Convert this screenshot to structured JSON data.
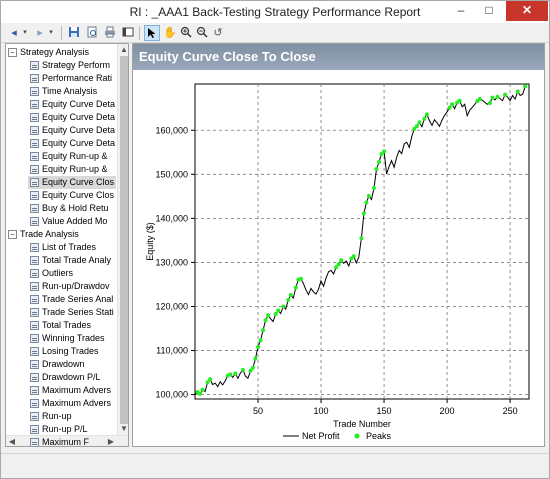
{
  "window": {
    "title": "RI : _AAA1 Back-Testing Strategy Performance Report",
    "minimize_glyph": "–",
    "maximize_glyph": "□",
    "close_glyph": "✕"
  },
  "toolbar": {
    "icons": [
      "back-arrow-icon",
      "dropdown-icon",
      "forward-arrow-icon",
      "dropdown-icon",
      "save-icon",
      "print-preview-icon",
      "print-icon",
      "layout-icon",
      "pointer-icon",
      "hand-pan-icon",
      "zoom-in-icon",
      "zoom-out-icon",
      "zoom-reset-icon"
    ]
  },
  "tree": {
    "groups": [
      {
        "label": "Strategy Analysis",
        "items": [
          "Strategy Perform",
          "Performance Rati",
          "Time Analysis",
          "Equity Curve Deta",
          "Equity Curve Deta",
          "Equity Curve Deta",
          "Equity Curve Deta",
          "Equity Run-up &",
          "Equity Run-up &",
          "Equity Curve Clos",
          "Equity Curve Clos",
          "Buy & Hold Retu",
          "Value Added Mo"
        ]
      },
      {
        "label": "Trade Analysis",
        "items": [
          "List of Trades",
          "Total Trade Analy",
          "Outliers",
          "Run-up/Drawdov",
          "Trade Series Anal",
          "Trade Series Stati",
          "Total Trades",
          "Winning Trades",
          "Losing Trades",
          "Drawdown",
          "Drawdown P/L",
          "Maximum Advers",
          "Maximum Advers",
          "Run-up",
          "Run-up P/L",
          "Maximum F"
        ]
      }
    ],
    "selected_index": 9
  },
  "panel": {
    "title": "Equity Curve Close To Close"
  },
  "chart_data": {
    "type": "line",
    "title": "",
    "xlabel": "Trade Number",
    "ylabel": "Equity ($)",
    "xlim": [
      0,
      265
    ],
    "ylim": [
      99000,
      170500
    ],
    "x_ticks": [
      50,
      100,
      150,
      200,
      250
    ],
    "y_ticks": [
      100000,
      110000,
      120000,
      130000,
      140000,
      150000,
      160000
    ],
    "y_tick_labels": [
      "100,000",
      "110,000",
      "120,000",
      "130,000",
      "140,000",
      "150,000",
      "160,000"
    ],
    "grid": true,
    "legend": "bottom",
    "series": [
      {
        "name": "Net Profit",
        "color": "#000000",
        "points": [
          [
            0,
            100000
          ],
          [
            2,
            100600
          ],
          [
            4,
            99900
          ],
          [
            6,
            101100
          ],
          [
            8,
            100700
          ],
          [
            10,
            102800
          ],
          [
            12,
            103500
          ],
          [
            14,
            102300
          ],
          [
            16,
            102600
          ],
          [
            18,
            101800
          ],
          [
            20,
            102900
          ],
          [
            22,
            102200
          ],
          [
            24,
            103100
          ],
          [
            26,
            104300
          ],
          [
            28,
            104600
          ],
          [
            30,
            103900
          ],
          [
            32,
            104800
          ],
          [
            34,
            103700
          ],
          [
            36,
            104900
          ],
          [
            38,
            105600
          ],
          [
            40,
            104200
          ],
          [
            42,
            103700
          ],
          [
            44,
            105300
          ],
          [
            46,
            106100
          ],
          [
            48,
            108200
          ],
          [
            50,
            110800
          ],
          [
            52,
            112300
          ],
          [
            54,
            114600
          ],
          [
            56,
            116900
          ],
          [
            58,
            118000
          ],
          [
            60,
            117200
          ],
          [
            62,
            116600
          ],
          [
            64,
            118300
          ],
          [
            66,
            119100
          ],
          [
            68,
            118400
          ],
          [
            70,
            120000
          ],
          [
            72,
            119400
          ],
          [
            74,
            121500
          ],
          [
            76,
            122600
          ],
          [
            78,
            121900
          ],
          [
            80,
            124300
          ],
          [
            82,
            126100
          ],
          [
            84,
            126300
          ],
          [
            86,
            125200
          ],
          [
            88,
            123800
          ],
          [
            90,
            122700
          ],
          [
            92,
            124100
          ],
          [
            94,
            123300
          ],
          [
            96,
            122800
          ],
          [
            98,
            123900
          ],
          [
            100,
            125800
          ],
          [
            102,
            124600
          ],
          [
            104,
            126500
          ],
          [
            106,
            127900
          ],
          [
            108,
            128200
          ],
          [
            110,
            127400
          ],
          [
            112,
            128900
          ],
          [
            114,
            129600
          ],
          [
            116,
            130500
          ],
          [
            118,
            129800
          ],
          [
            120,
            130300
          ],
          [
            122,
            129200
          ],
          [
            124,
            130900
          ],
          [
            126,
            131400
          ],
          [
            128,
            129900
          ],
          [
            130,
            131200
          ],
          [
            132,
            135500
          ],
          [
            134,
            141100
          ],
          [
            136,
            143600
          ],
          [
            138,
            145100
          ],
          [
            140,
            144300
          ],
          [
            142,
            146900
          ],
          [
            144,
            151200
          ],
          [
            146,
            152800
          ],
          [
            148,
            154600
          ],
          [
            150,
            155200
          ],
          [
            152,
            150100
          ],
          [
            154,
            151800
          ],
          [
            156,
            153100
          ],
          [
            158,
            151600
          ],
          [
            160,
            153900
          ],
          [
            162,
            155400
          ],
          [
            164,
            154700
          ],
          [
            166,
            156900
          ],
          [
            168,
            157300
          ],
          [
            170,
            156100
          ],
          [
            172,
            158600
          ],
          [
            174,
            160300
          ],
          [
            176,
            160900
          ],
          [
            178,
            161800
          ],
          [
            180,
            160800
          ],
          [
            182,
            162600
          ],
          [
            184,
            163600
          ],
          [
            186,
            162200
          ],
          [
            188,
            161100
          ],
          [
            190,
            162400
          ],
          [
            192,
            161700
          ],
          [
            194,
            160900
          ],
          [
            196,
            162300
          ],
          [
            198,
            163400
          ],
          [
            200,
            164200
          ],
          [
            202,
            165100
          ],
          [
            204,
            165900
          ],
          [
            206,
            164900
          ],
          [
            208,
            166300
          ],
          [
            210,
            166700
          ],
          [
            212,
            165300
          ],
          [
            214,
            165900
          ],
          [
            216,
            163300
          ],
          [
            218,
            164600
          ],
          [
            220,
            165200
          ],
          [
            222,
            165900
          ],
          [
            224,
            166600
          ],
          [
            226,
            167100
          ],
          [
            228,
            166800
          ],
          [
            230,
            166300
          ],
          [
            232,
            165900
          ],
          [
            234,
            166200
          ],
          [
            236,
            167400
          ],
          [
            238,
            166900
          ],
          [
            240,
            167600
          ],
          [
            242,
            167200
          ],
          [
            244,
            166700
          ],
          [
            246,
            168100
          ],
          [
            248,
            167500
          ],
          [
            250,
            166700
          ],
          [
            252,
            167900
          ],
          [
            254,
            167100
          ],
          [
            256,
            168800
          ],
          [
            258,
            167900
          ],
          [
            260,
            168200
          ],
          [
            262,
            170000
          ]
        ]
      },
      {
        "name": "Peaks",
        "color": "#22ee22",
        "points": [
          [
            2,
            100600
          ],
          [
            4,
            100200
          ],
          [
            6,
            101100
          ],
          [
            10,
            102800
          ],
          [
            12,
            103500
          ],
          [
            26,
            104300
          ],
          [
            28,
            104600
          ],
          [
            32,
            104800
          ],
          [
            38,
            105600
          ],
          [
            44,
            105400
          ],
          [
            46,
            106100
          ],
          [
            48,
            108200
          ],
          [
            50,
            110800
          ],
          [
            52,
            112300
          ],
          [
            54,
            114600
          ],
          [
            56,
            116900
          ],
          [
            58,
            118000
          ],
          [
            64,
            118300
          ],
          [
            66,
            119100
          ],
          [
            70,
            120000
          ],
          [
            74,
            121500
          ],
          [
            76,
            122600
          ],
          [
            80,
            124300
          ],
          [
            82,
            126100
          ],
          [
            84,
            126300
          ],
          [
            112,
            128900
          ],
          [
            114,
            129600
          ],
          [
            116,
            130500
          ],
          [
            124,
            130900
          ],
          [
            126,
            131400
          ],
          [
            132,
            135500
          ],
          [
            134,
            141100
          ],
          [
            136,
            143600
          ],
          [
            138,
            145100
          ],
          [
            142,
            146900
          ],
          [
            144,
            151200
          ],
          [
            146,
            152800
          ],
          [
            148,
            154600
          ],
          [
            150,
            155200
          ],
          [
            174,
            160300
          ],
          [
            176,
            160900
          ],
          [
            178,
            161800
          ],
          [
            182,
            162600
          ],
          [
            184,
            163600
          ],
          [
            202,
            165100
          ],
          [
            204,
            165900
          ],
          [
            208,
            166300
          ],
          [
            210,
            166700
          ],
          [
            224,
            166600
          ],
          [
            226,
            167100
          ],
          [
            234,
            166200
          ],
          [
            236,
            167400
          ],
          [
            240,
            167600
          ],
          [
            246,
            168100
          ],
          [
            256,
            168800
          ],
          [
            262,
            170000
          ]
        ]
      }
    ]
  }
}
